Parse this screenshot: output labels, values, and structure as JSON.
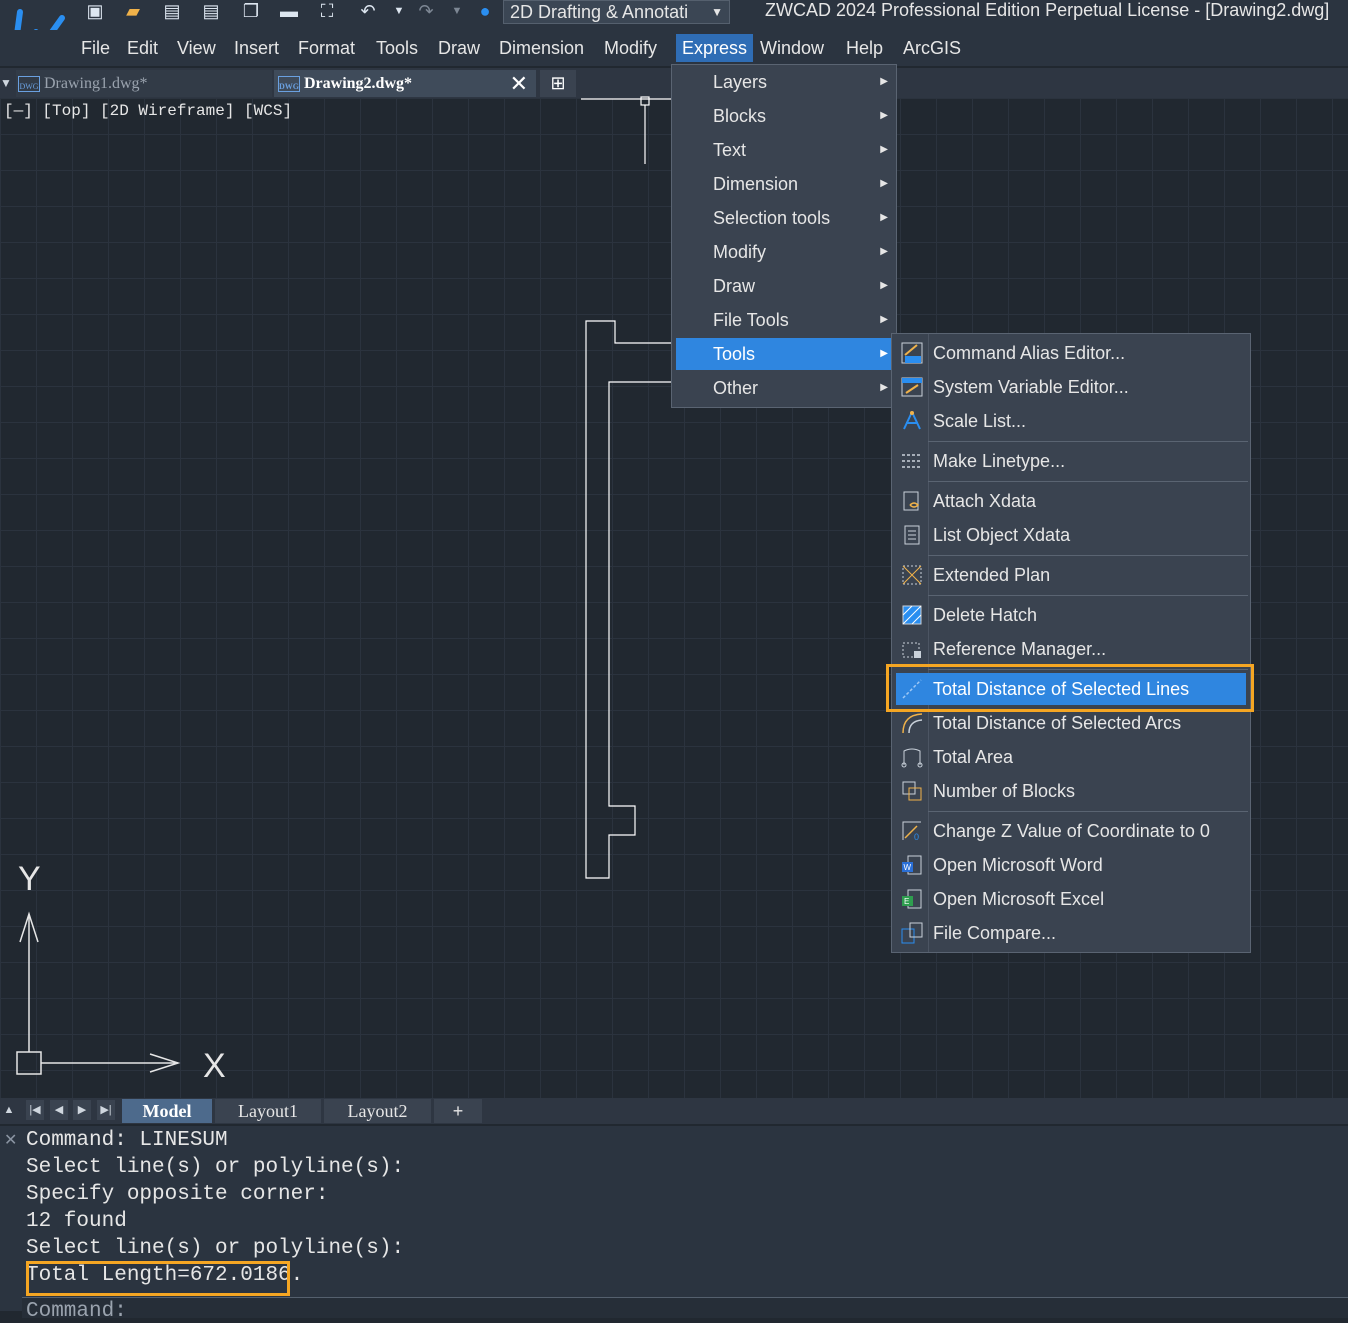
{
  "window": {
    "title": "ZWCAD 2024 Professional Edition Perpetual License - [Drawing2.dwg]",
    "workspace": "2D Drafting & Annotati"
  },
  "menubar": [
    "File",
    "Edit",
    "View",
    "Insert",
    "Format",
    "Tools",
    "Draw",
    "Dimension",
    "Modify",
    "Express",
    "Window",
    "Help",
    "ArcGIS"
  ],
  "tabs": [
    {
      "label": "Drawing1.dwg*",
      "active": false
    },
    {
      "label": "Drawing2.dwg*",
      "active": true
    }
  ],
  "viewport_label": "[—] [Top] [2D Wireframe] [WCS]",
  "ucs": {
    "x_label": "X",
    "y_label": "Y"
  },
  "express_menu": [
    {
      "label": "Layers"
    },
    {
      "label": "Blocks"
    },
    {
      "label": "Text"
    },
    {
      "label": "Dimension"
    },
    {
      "label": "Selection tools"
    },
    {
      "label": "Modify"
    },
    {
      "label": "Draw"
    },
    {
      "label": "File Tools"
    },
    {
      "label": "Tools",
      "selected": true
    },
    {
      "label": "Other"
    }
  ],
  "tools_menu": [
    {
      "label": "Command Alias Editor...",
      "icon": "pgp-icon"
    },
    {
      "label": "System Variable Editor...",
      "icon": "sysvar-icon"
    },
    {
      "label": "Scale List...",
      "icon": "scale-icon"
    },
    {
      "label": "Make Linetype...",
      "icon": "linetype-icon"
    },
    {
      "label": "Attach Xdata",
      "icon": "attach-xdata-icon"
    },
    {
      "label": "List Object Xdata",
      "icon": "list-xdata-icon"
    },
    {
      "label": "Extended Plan",
      "icon": "plan-icon"
    },
    {
      "label": "Delete Hatch",
      "icon": "hatch-icon"
    },
    {
      "label": "Reference Manager...",
      "icon": "refmgr-icon"
    },
    {
      "label": "Total Distance of Selected Lines",
      "icon": "lines-icon",
      "selected": true
    },
    {
      "label": "Total Distance of Selected Arcs",
      "icon": "arcs-icon"
    },
    {
      "label": "Total Area",
      "icon": "area-icon"
    },
    {
      "label": "Number of Blocks",
      "icon": "blocks-icon"
    },
    {
      "label": "Change Z Value of Coordinate to 0",
      "icon": "zvalue-icon"
    },
    {
      "label": "Open Microsoft Word",
      "icon": "word-icon"
    },
    {
      "label": "Open Microsoft Excel",
      "icon": "excel-icon"
    },
    {
      "label": "File Compare...",
      "icon": "compare-icon"
    }
  ],
  "layout_tabs": [
    "Model",
    "Layout1",
    "Layout2",
    "+"
  ],
  "command_history": [
    "Command: LINESUM",
    "Select line(s) or polyline(s):",
    "Specify opposite corner:",
    "12 found",
    "Select line(s) or polyline(s):",
    "Total Length=672.0186."
  ],
  "command_prompt": "Command:"
}
